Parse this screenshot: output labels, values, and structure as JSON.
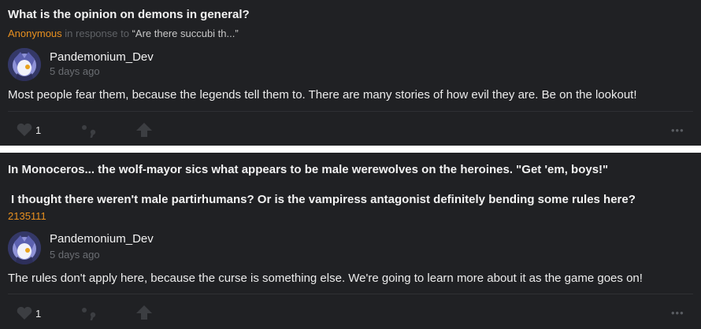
{
  "posts": [
    {
      "question": "What is the opinion on demons in general?",
      "asker": "Anonymous",
      "in_response_to_label": "in response to",
      "in_response_to_quote": "“Are there succubi th...”",
      "author": "Pandemonium_Dev",
      "time": "5 days ago",
      "answer": "Most people fear them, because the legends tell them to. There are many stories of how evil they are. Be on the lookout!",
      "like_count": "1",
      "more_label": "•••"
    },
    {
      "question_line1": "In Monoceros... the wolf-mayor sics what appears to be male werewolves on the heroines. \"Get 'em, boys!\"",
      "question_line2": "I thought there weren't male partirhumans? Or is the vampiress antagonist definitely bending some rules here?",
      "asker": "2135111",
      "author": "Pandemonium_Dev",
      "time": "5 days ago",
      "answer": "The rules don't apply here, because the curse is something else. We're going to learn more about it as the game goes on!",
      "like_count": "1",
      "more_label": "•••"
    }
  ],
  "colors": {
    "card_bg": "#202124",
    "asker": "#e8901f",
    "muted": "#5f6266",
    "icon": "#3c3e42"
  },
  "icons": [
    "heart-icon",
    "quote-icon",
    "share-arrow-icon",
    "more-dots-icon"
  ]
}
